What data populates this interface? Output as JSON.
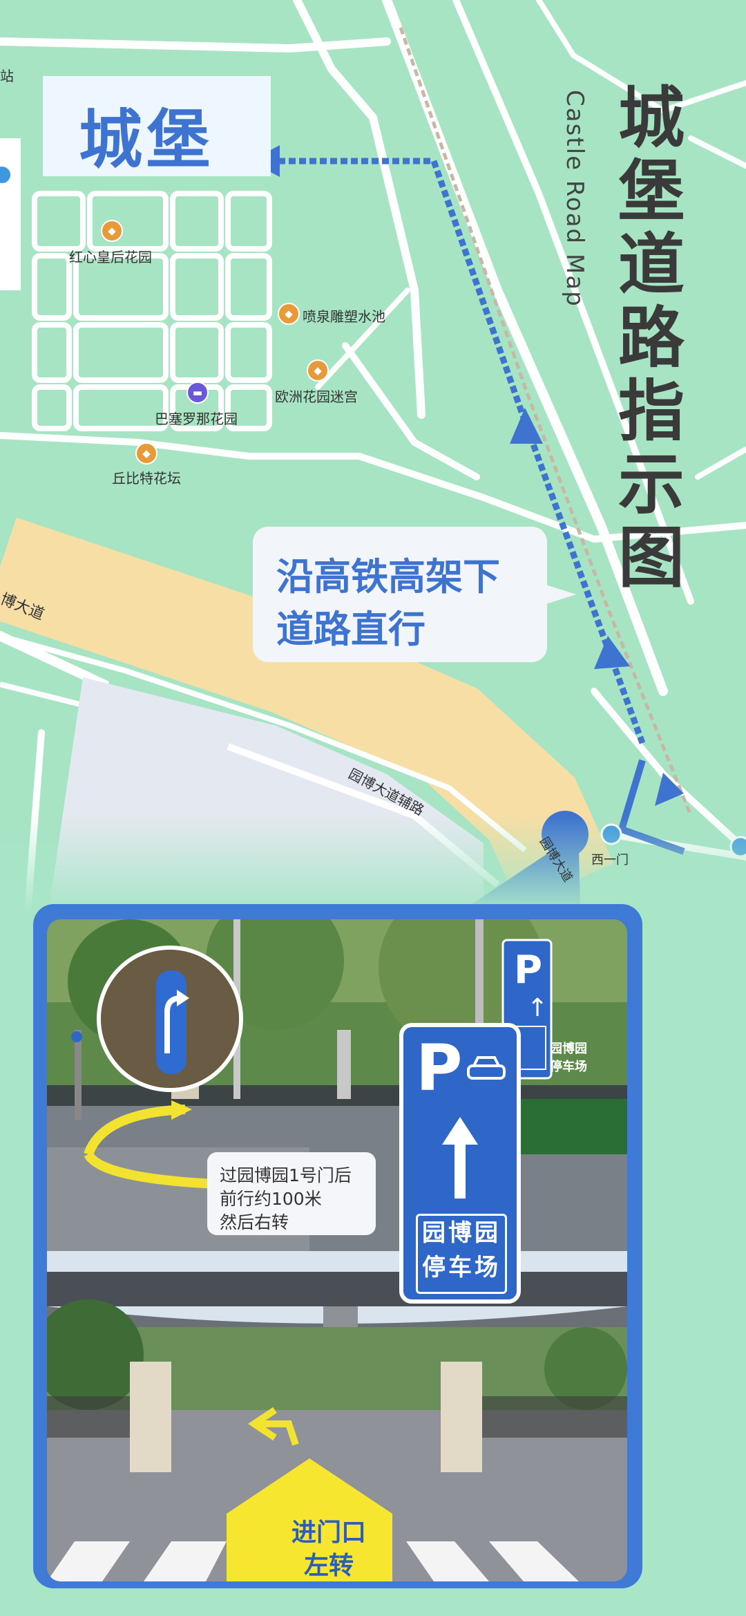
{
  "map": {
    "title_vertical": "城堡道路指示图",
    "subtitle": "Castle Road Map",
    "destination": "城堡",
    "route_callout_line1": "沿高铁高架下",
    "route_callout_line2": "道路直行",
    "pois": [
      {
        "label": "红心皇后花园",
        "type": "scenic"
      },
      {
        "label": "喷泉雕塑水池",
        "type": "scenic"
      },
      {
        "label": "欧洲花园迷宫",
        "type": "scenic"
      },
      {
        "label": "巴塞罗那花园",
        "type": "hotel"
      },
      {
        "label": "丘比特花坛",
        "type": "scenic"
      }
    ],
    "road_labels": {
      "main_road": "博大道",
      "aux_road": "园博大道辅路",
      "gate": "西一门",
      "road_turn": "园博大道",
      "edge_station": "站"
    },
    "colors": {
      "map_bg": "#a6e4c4",
      "road": "#f6dea5",
      "route": "#3e73cf",
      "callout_text": "#3e73cf"
    }
  },
  "photos": {
    "sign_inset": {
      "letter": "P",
      "line1": "园博园",
      "line2": "停车场"
    },
    "sign_small": {
      "letter": "P",
      "line1": "园博园",
      "line2": "停车场"
    },
    "tip_line1": "过园博园1号门后",
    "tip_line2": "前行约100米",
    "tip_line3": "然后右转",
    "enter_line1": "进门口",
    "enter_line2": "左转"
  }
}
